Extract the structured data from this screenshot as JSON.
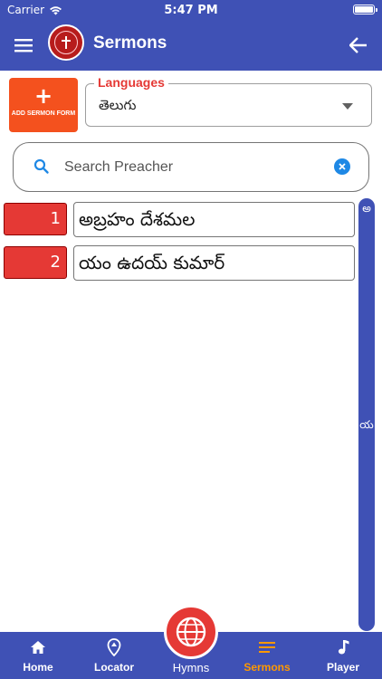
{
  "status_bar": {
    "carrier": "Carrier",
    "time": "5:47 PM"
  },
  "app_bar": {
    "title": "Sermons"
  },
  "add_sermon": {
    "plus": "+",
    "label": "ADD SERMON FORM"
  },
  "languages": {
    "label": "Languages",
    "selected": "తెలుగు"
  },
  "search": {
    "placeholder": "Search Preacher",
    "value": ""
  },
  "preachers": [
    {
      "number": "1",
      "name": "అబ్రహం దేశమల"
    },
    {
      "number": "2",
      "name": "యం ఉదయ్ కుమార్"
    }
  ],
  "alphabet_index": [
    "అ",
    "య"
  ],
  "bottom_nav": {
    "home": "Home",
    "locator": "Locator",
    "hymns": "Hymns",
    "sermons": "Sermons",
    "player": "Player"
  },
  "colors": {
    "primary": "#3f51b5",
    "accent_red": "#e53935",
    "add_button": "#f4511e",
    "active_nav": "#ff9800",
    "clear_icon": "#1e88e5"
  }
}
